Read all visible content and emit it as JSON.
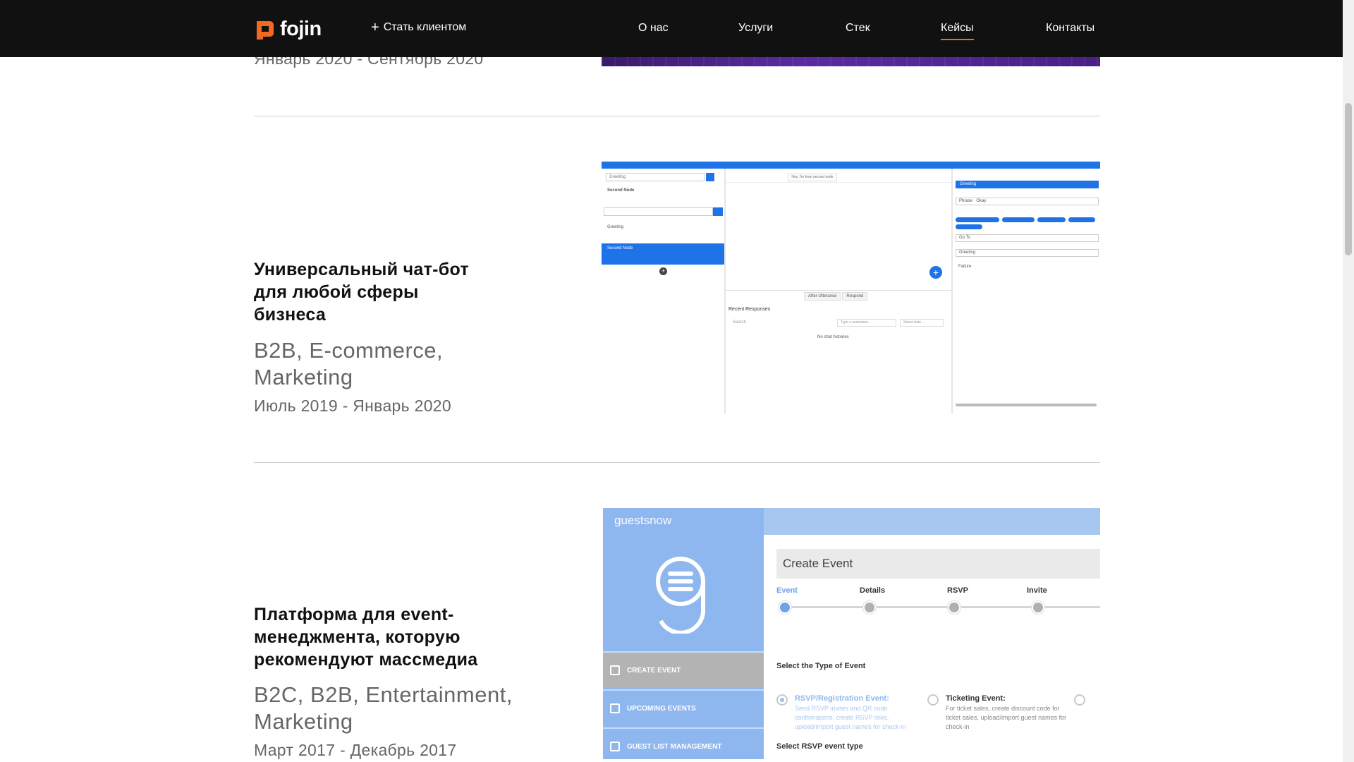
{
  "header": {
    "logo_text": "fojin",
    "cta_label": "Стать клиентом",
    "nav": [
      {
        "label": "О нас",
        "active": false
      },
      {
        "label": "Услуги",
        "active": false
      },
      {
        "label": "Стек",
        "active": false
      },
      {
        "label": "Кейсы",
        "active": true
      },
      {
        "label": "Контакты",
        "active": false
      }
    ],
    "accent_color": "#f26a21"
  },
  "cases": [
    {
      "dates": "Январь 2020 - Сентябрь 2020"
    },
    {
      "title_lines": [
        "Универсальный чат-бот",
        "для любой сферы",
        "бизнеса"
      ],
      "tags_lines": [
        "B2B, E-commerce,",
        "Marketing"
      ],
      "dates": "Июль 2019 - Январь 2020"
    },
    {
      "title_lines": [
        "Платформа для event-",
        "менеджмента, которую",
        "рекомендуют массмедиа"
      ],
      "tags_lines": [
        "B2C, B2B, Entertainment,",
        "Marketing"
      ],
      "dates": "Март 2017 - Декабрь 2017"
    }
  ],
  "chatbot_shot": {
    "select_value": "Greeting",
    "second_node_label": "Second Node",
    "node_greeting": "Greeting",
    "node_second": "Second Node",
    "hey_text": "Hey, I'm from second node",
    "tab_after": "After Utterance",
    "tab_respond": "Respond",
    "recent_responses": "Recent Responses",
    "search_label": "Search",
    "username_placeholder": "Type a username...",
    "date_placeholder": "Select date...",
    "no_chats": "No chat histories",
    "right_header": "Greeting",
    "phrase_label": "Phrase",
    "phrase_value": "Okay",
    "goto_label": "Go To",
    "destination_value": "Greeting",
    "failure_label": "Failure"
  },
  "event_shot": {
    "brand": "guestsnow",
    "menu": [
      {
        "label": "CREATE EVENT",
        "active": true
      },
      {
        "label": "UPCOMING EVENTS",
        "active": false
      },
      {
        "label": "GUEST LIST MANAGEMENT",
        "active": false
      }
    ],
    "create_title": "Create Event",
    "steps": [
      "Event",
      "Details",
      "RSVP",
      "Invite"
    ],
    "type_heading": "Select the Type of Event",
    "options": [
      {
        "title": "RSVP/Registration Event:",
        "desc": "Send RSVP invites and QR code confirmations, create RSVP links, upload/import guest names for check-in",
        "active": true
      },
      {
        "title": "Ticketing Event:",
        "desc": "For ticket sales, create discount code for ticket sales, upload/import guest names for check-in",
        "active": false
      }
    ],
    "rsvp_type_heading": "Select RSVP event type"
  }
}
